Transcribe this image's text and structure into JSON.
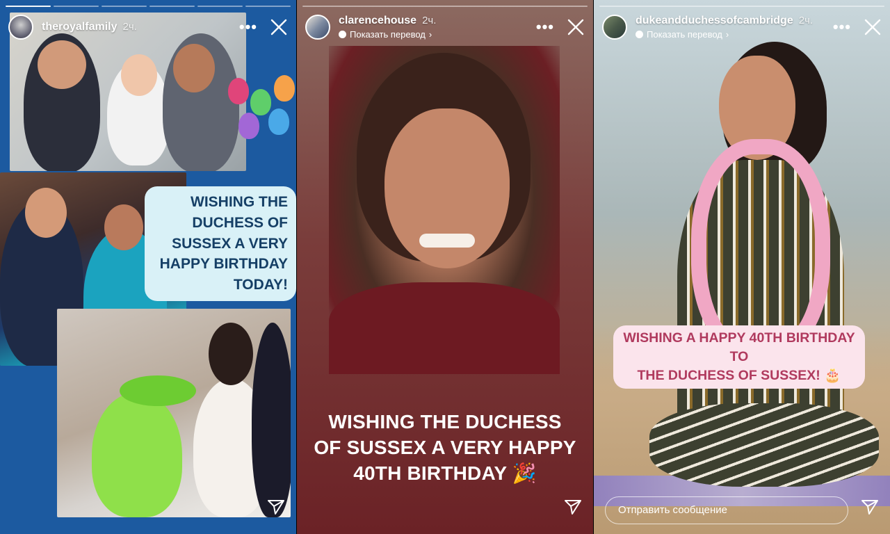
{
  "stories": [
    {
      "username": "theroyalfamily",
      "time": "2ч.",
      "more": "•••",
      "progress_segments": 6,
      "progress_done": 1,
      "sticker_lines": [
        "WISHING THE",
        "DUCHESS OF",
        "SUSSEX A VERY",
        "HAPPY BIRTHDAY",
        "TODAY!"
      ]
    },
    {
      "username": "clarencehouse",
      "time": "2ч.",
      "translate": "Показать перевод",
      "more": "•••",
      "progress_segments": 1,
      "progress_done": 0,
      "caption_lines": [
        "WISHING THE DUCHESS",
        "OF SUSSEX A VERY HAPPY",
        "40TH BIRTHDAY 🎉"
      ]
    },
    {
      "username": "dukeandduchessofcambridge",
      "time": "2ч.",
      "translate": "Показать перевод",
      "more": "•••",
      "progress_segments": 1,
      "progress_done": 0,
      "caption_lines": [
        "WISHING A HAPPY 40TH BIRTHDAY TO",
        "THE DUCHESS OF SUSSEX! 🎂"
      ],
      "reply_placeholder": "Отправить сообщение"
    }
  ],
  "icons": {
    "close": "close-icon",
    "more": "more-icon",
    "send": "send-icon",
    "translate": "translate-icon"
  },
  "colors": {
    "story1_bg": "#1c5aa0",
    "sticker1_bg": "#d9f1f7",
    "sticker1_text": "#153f66",
    "sticker3_bg": "#fbe4ec",
    "sticker3_text": "#b03a5e"
  }
}
